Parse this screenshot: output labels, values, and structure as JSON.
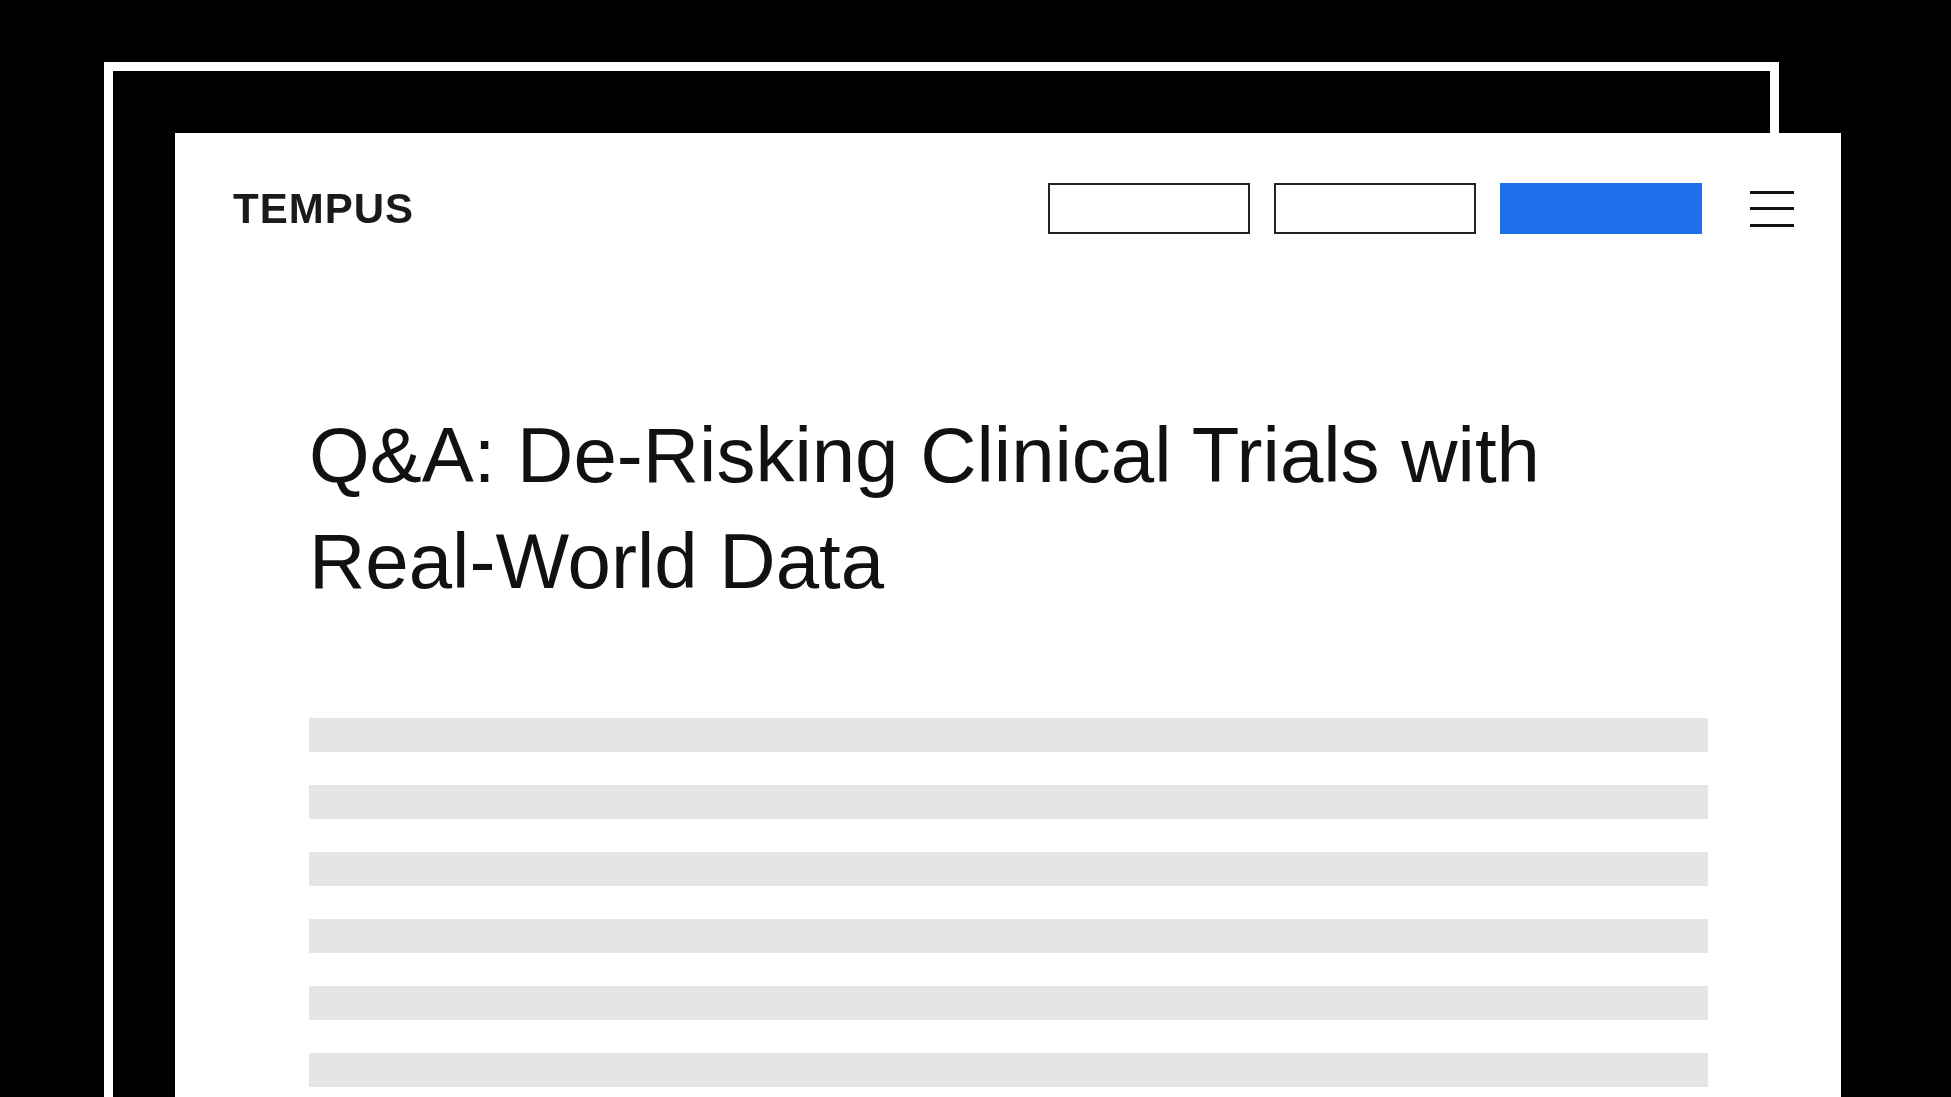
{
  "logo": {
    "text": "TEMPUS"
  },
  "nav_buttons": [
    {
      "kind": "outline"
    },
    {
      "kind": "outline"
    },
    {
      "kind": "filled"
    }
  ],
  "article": {
    "title": "Q&A: De-Risking Clinical Trials with Real-World Data"
  }
}
